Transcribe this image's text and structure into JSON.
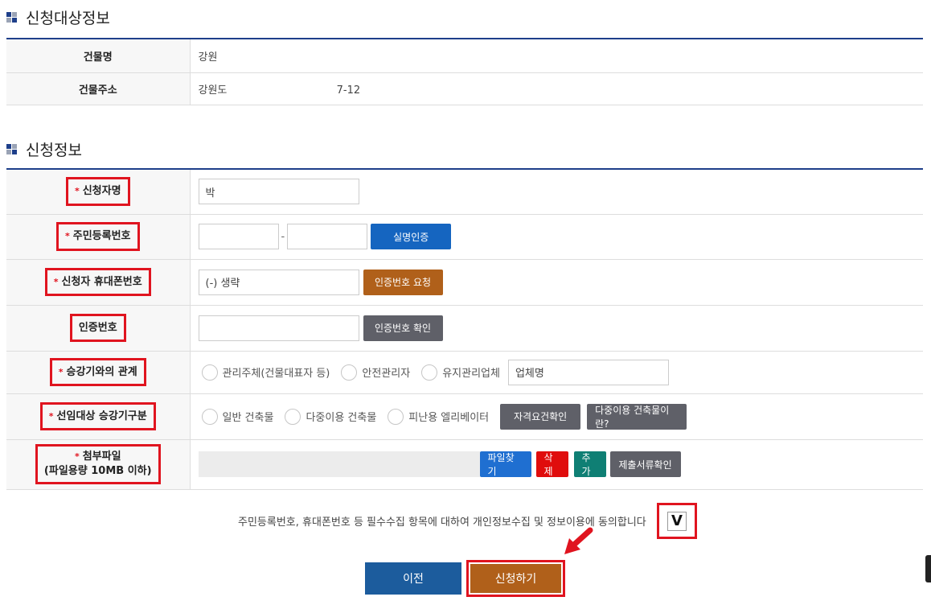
{
  "section1": {
    "title": "신청대상정보",
    "rows": [
      {
        "label": "건물명",
        "value": "강원"
      },
      {
        "label": "건물주소",
        "value": "강원도",
        "value2": "7-12"
      }
    ]
  },
  "section2": {
    "title": "신청정보",
    "required_mark": "*",
    "applicant_name": {
      "label": "신청자명",
      "value": "박"
    },
    "resident_no": {
      "label": "주민등록번호",
      "separator": "-",
      "verify_button": "실명인증"
    },
    "phone": {
      "label": "신청자 휴대폰번호",
      "value": "(-) 생략",
      "request_button": "인증번호 요청"
    },
    "auth_code": {
      "label": "인증번호",
      "confirm_button": "인증번호 확인"
    },
    "relation": {
      "label": "승강기와의 관계",
      "options": [
        "관리주체(건물대표자 등)",
        "안전관리자",
        "유지관리업체"
      ],
      "company_placeholder": "업체명"
    },
    "category": {
      "label": "선임대상 승강기구분",
      "options": [
        "일반 건축물",
        "다중이용 건축물",
        "피난용 엘리베이터"
      ],
      "qualify_button": "자격요건확인",
      "info_button": "다중이용 건축물이란?"
    },
    "attachment": {
      "label": "첨부파일",
      "label_note": "(파일용량 10MB 이하)",
      "find_button": "파일찾기",
      "delete_button": "삭제",
      "add_button": "추가",
      "docs_button": "제출서류확인"
    }
  },
  "agreement": {
    "text": "주민등록번호, 휴대폰번호 등 필수수집 항목에 대하여 개인정보수집 및 정보이용에 동의합니다",
    "check_mark": "V"
  },
  "buttons": {
    "prev": "이전",
    "apply": "신청하기"
  },
  "colors": {
    "navy": "#1e3f8a",
    "highlight": "#e0141f",
    "brown": "#b0601a",
    "blue": "#1565c0"
  }
}
